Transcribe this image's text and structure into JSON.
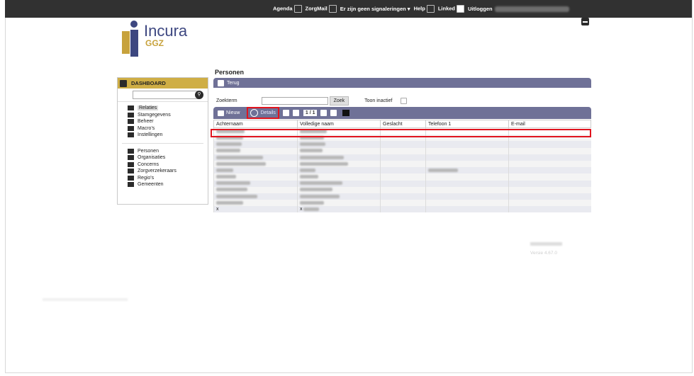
{
  "topbar": {
    "agenda": "Agenda",
    "zorgmail": "ZorgMail",
    "signaleringen": "Er zijn geen signaleringen",
    "help": "Help",
    "linked": "Linked",
    "uitloggen": "Uitloggen"
  },
  "logo": {
    "brand": "Incura",
    "sub": "GGZ"
  },
  "sidebar": {
    "dashboard": "DASHBOARD",
    "group1": [
      "Relaties",
      "Stamgegevens",
      "Beheer",
      "Macro's",
      "Instellingen"
    ],
    "group2": [
      "Personen",
      "Organisaties",
      "Concerns",
      "Zorgverzekeraars",
      "Regio's",
      "Gemeenten"
    ]
  },
  "page": {
    "title": "Personen",
    "back": "Terug",
    "zoekterm_label": "Zoekterm",
    "zoek_button": "Zoek",
    "toon_inactief": "Toon inactief"
  },
  "toolbar": {
    "nieuw": "Nieuw",
    "details": "Details",
    "page_indicator": "1 / 1"
  },
  "table": {
    "columns": [
      "Achternaam",
      "Volledige naam",
      "Geslacht",
      "Telefoon 1",
      "E-mail"
    ],
    "last_row": [
      "x",
      "x"
    ]
  },
  "footer": {
    "versie": "Versie 4.67.0"
  },
  "colors": {
    "accent_bar": "#6f7197",
    "gold": "#cfae45",
    "highlight": "#e0141e"
  }
}
